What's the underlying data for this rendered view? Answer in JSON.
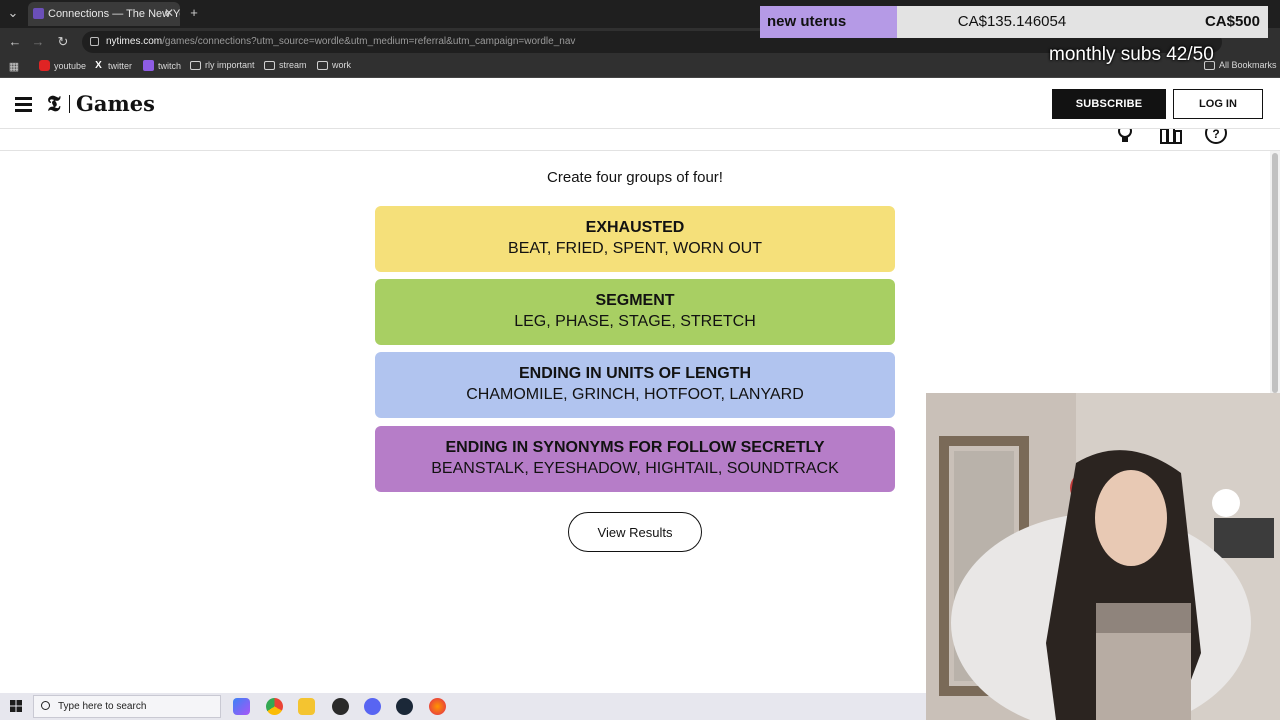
{
  "browser": {
    "tab_title": "Connections — The New York T",
    "url_host": "nytimes.com",
    "url_path": "/games/connections?utm_source=wordle&utm_medium=referral&utm_campaign=wordle_nav",
    "bookmarks": [
      {
        "label": "youtube",
        "icon": "youtube-icon"
      },
      {
        "label": "twitter",
        "icon": "x-icon"
      },
      {
        "label": "twitch",
        "icon": "twitch-icon"
      },
      {
        "label": "rly important",
        "icon": "folder-icon"
      },
      {
        "label": "stream",
        "icon": "folder-icon"
      },
      {
        "label": "work",
        "icon": "folder-icon"
      }
    ],
    "all_bookmarks_label": "All Bookmarks"
  },
  "overlay": {
    "goal_label": "new uterus",
    "goal_current": "CA$135.146054",
    "goal_target": "CA$500",
    "subs_text": "monthly subs 42/50"
  },
  "header": {
    "logo": "Games",
    "subscribe_label": "SUBSCRIBE",
    "login_label": "LOG IN"
  },
  "game": {
    "prompt": "Create four groups of four!",
    "groups": [
      {
        "title": "EXHAUSTED",
        "words": "BEAT, FRIED, SPENT, WORN OUT",
        "color": "#f5e07a"
      },
      {
        "title": "SEGMENT",
        "words": "LEG, PHASE, STAGE, STRETCH",
        "color": "#a8cf63"
      },
      {
        "title": "ENDING IN UNITS OF LENGTH",
        "words": "CHAMOMILE, GRINCH, HOTFOOT, LANYARD",
        "color": "#b1c4ef"
      },
      {
        "title": "ENDING IN SYNONYMS FOR FOLLOW SECRETLY",
        "words": "BEANSTALK, EYESHADOW, HIGHTAIL, SOUNDTRACK",
        "color": "#b67dc8"
      }
    ],
    "results_label": "View Results"
  },
  "taskbar": {
    "search_placeholder": "Type here to search"
  }
}
